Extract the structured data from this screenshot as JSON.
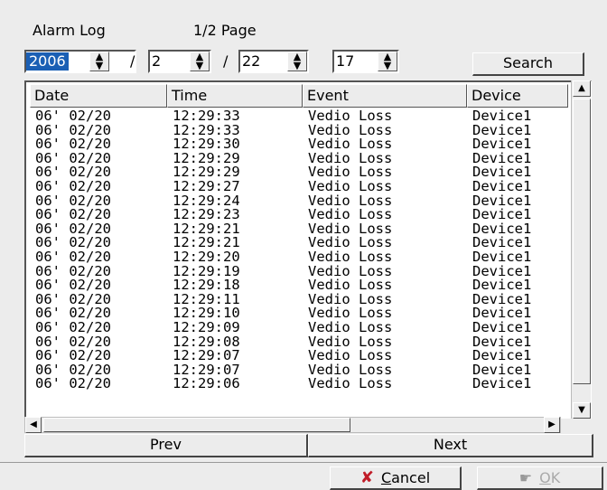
{
  "header": {
    "title": "Alarm Log",
    "page_indicator": "1/2 Page"
  },
  "filters": {
    "year": "2006",
    "month": "2",
    "day": "22",
    "hour": "17",
    "separator": "/",
    "search_label": "Search"
  },
  "table": {
    "columns": [
      "Date",
      "Time",
      "Event",
      "Device"
    ],
    "rows": [
      [
        "06' 02/20",
        "12:29:33",
        "Vedio Loss",
        "Device1"
      ],
      [
        "06' 02/20",
        "12:29:33",
        "Vedio Loss",
        "Device1"
      ],
      [
        "06' 02/20",
        "12:29:30",
        "Vedio Loss",
        "Device1"
      ],
      [
        "06' 02/20",
        "12:29:29",
        "Vedio Loss",
        "Device1"
      ],
      [
        "06' 02/20",
        "12:29:29",
        "Vedio Loss",
        "Device1"
      ],
      [
        "06' 02/20",
        "12:29:27",
        "Vedio Loss",
        "Device1"
      ],
      [
        "06' 02/20",
        "12:29:24",
        "Vedio Loss",
        "Device1"
      ],
      [
        "06' 02/20",
        "12:29:23",
        "Vedio Loss",
        "Device1"
      ],
      [
        "06' 02/20",
        "12:29:21",
        "Vedio Loss",
        "Device1"
      ],
      [
        "06' 02/20",
        "12:29:21",
        "Vedio Loss",
        "Device1"
      ],
      [
        "06' 02/20",
        "12:29:20",
        "Vedio Loss",
        "Device1"
      ],
      [
        "06' 02/20",
        "12:29:19",
        "Vedio Loss",
        "Device1"
      ],
      [
        "06' 02/20",
        "12:29:18",
        "Vedio Loss",
        "Device1"
      ],
      [
        "06' 02/20",
        "12:29:11",
        "Vedio Loss",
        "Device1"
      ],
      [
        "06' 02/20",
        "12:29:10",
        "Vedio Loss",
        "Device1"
      ],
      [
        "06' 02/20",
        "12:29:09",
        "Vedio Loss",
        "Device1"
      ],
      [
        "06' 02/20",
        "12:29:08",
        "Vedio Loss",
        "Device1"
      ],
      [
        "06' 02/20",
        "12:29:07",
        "Vedio Loss",
        "Device1"
      ],
      [
        "06' 02/20",
        "12:29:07",
        "Vedio Loss",
        "Device1"
      ],
      [
        "06' 02/20",
        "12:29:06",
        "Vedio Loss",
        "Device1"
      ]
    ]
  },
  "navigation": {
    "prev_label": "Prev",
    "next_label": "Next"
  },
  "dialog": {
    "cancel_label": "Cancel",
    "ok_label": "OK",
    "cancel_icon": "cancel-x-icon",
    "ok_icon": "ok-hand-icon",
    "cancel_icon_color": "#c01c28"
  }
}
